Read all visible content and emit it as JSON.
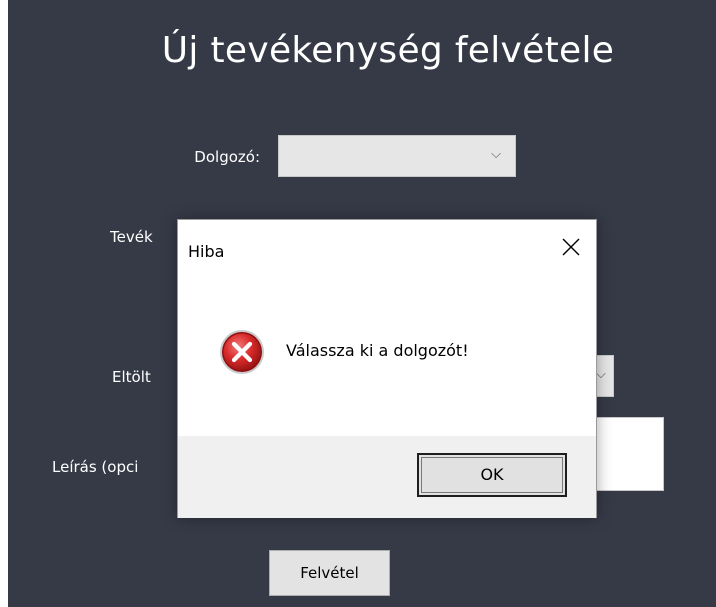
{
  "form": {
    "title": "Új tevékenység felvétele",
    "labels": {
      "dolgozo": "Dolgozó:",
      "tevekenyseg_partial": "Tevék",
      "eltoltott_partial": "Eltölt",
      "leiras_partial": "Leírás (opci"
    },
    "dolgozo_value": "",
    "submit_label": "Felvétel"
  },
  "dialog": {
    "title": "Hiba",
    "message": "Válassza ki a dolgozót!",
    "ok_label": "OK",
    "icon": "error-icon",
    "colors": {
      "error_red": "#d92b2b",
      "background": "#363a47"
    }
  }
}
